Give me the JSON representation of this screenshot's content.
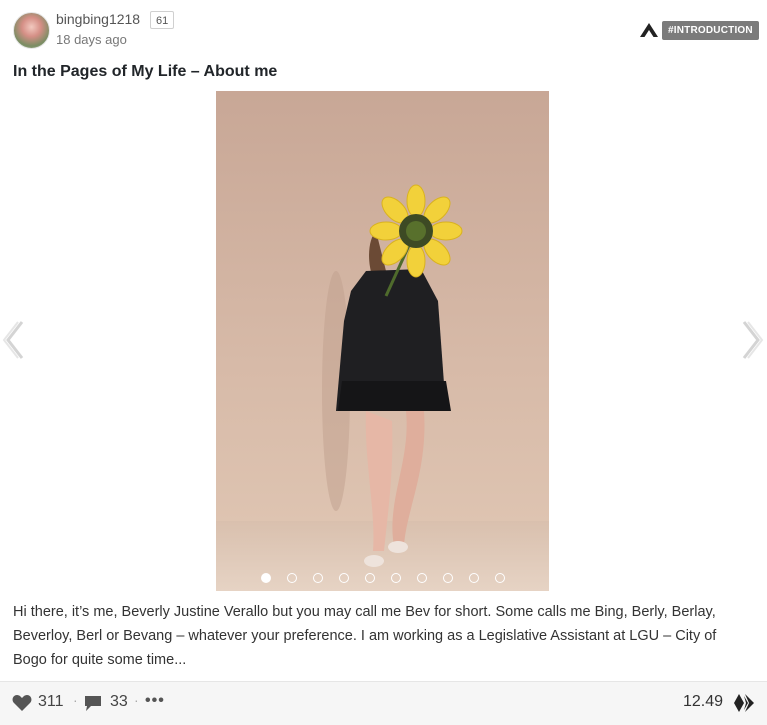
{
  "post": {
    "author": "bingbing1218",
    "reputation": "61",
    "time_ago": "18 days ago",
    "community_icon": "community-a-icon",
    "tag": "#INTRODUCTION",
    "title": "In the Pages of My Life – About me",
    "carousel": {
      "slide_count": 10,
      "active_index": 0,
      "prev_icon": "chevron-left-icon",
      "next_icon": "chevron-right-icon",
      "image_description_icon": "photo-woman-holding-sunflower"
    },
    "excerpt": "Hi there, it’s me, Beverly Justine Verallo but you may call me Bev for short. Some calls me Bing, Berly, Berlay, Beverloy, Berl or Bevang – whatever your preference. I am working as a Legislative Assistant at LGU – City of Bogo for quite some time...",
    "footer": {
      "votes": "311",
      "comments": "33",
      "payout": "12.49",
      "vote_icon": "heart-icon",
      "comment_icon": "comment-icon",
      "more_icon": "more-icon",
      "currency_icon": "hive-icon"
    }
  }
}
